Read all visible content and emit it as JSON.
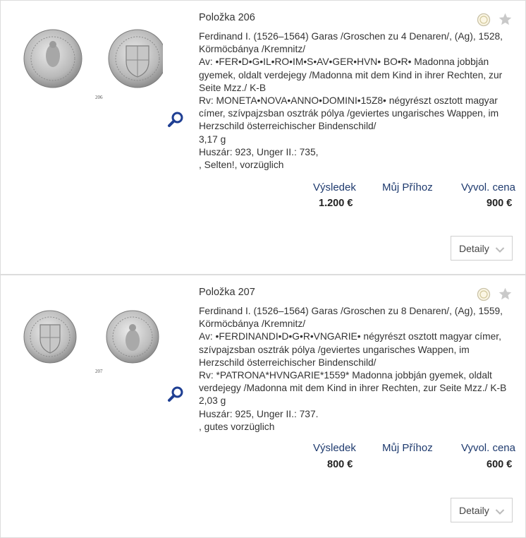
{
  "lots": [
    {
      "title": "Položka 206",
      "lines": [
        "Ferdinand I. (1526–1564) Garas /Groschen zu 4 Denaren/, (Ag), 1528,",
        "Körmöcbánya /Kremnitz/",
        "Av: •FER•D•G•IL•RO•IM•S•AV•GER•HVN• BO•R• Madonna jobbján",
        "gyemek, oldalt verdejegy /Madonna mit dem Kind in ihrer Rechten, zur",
        "Seite Mzz./ K-B",
        "Rv: MONETA•NOVA•ANNO•DOMINI•15Z8• négyrészt osztott magyar",
        "címer, szívpajzsban osztrák pólya /geviertes ungarisches Wappen, im",
        "Herzschild österreichischer Bindenschild/",
        "3,17 g",
        "Huszár: 923, Unger II.: 735,",
        ", Selten!, vorzüglich"
      ],
      "image_number": "206",
      "result_label": "Výsledek",
      "result_value": "1.200 €",
      "mybid_label": "Můj Příhoz",
      "start_label": "Vyvol. cena",
      "start_value": "900 €",
      "detail_label": "Detaily"
    },
    {
      "title": "Položka 207",
      "lines": [
        "Ferdinand I. (1526–1564) Garas /Groschen zu 8 Denaren/, (Ag), 1559,",
        "Körmöcbánya /Kremnitz/",
        "Av: •FERDINANDI•D•G•R•VNGARIE• négyrészt osztott magyar címer,",
        "szívpajzsban osztrák pólya /geviertes ungarisches Wappen, im",
        "Herzschild österreichischer Bindenschild/",
        "Rv: *PATRONA*HVNGARIE*1559* Madonna jobbján gyemek, oldalt",
        "verdejegy /Madonna mit dem Kind in ihrer Rechten, zur Seite Mzz./ K-B",
        "2,03 g",
        "Huszár: 925, Unger II.: 737.",
        ", gutes vorzüglich"
      ],
      "image_number": "207",
      "result_label": "Výsledek",
      "result_value": "800 €",
      "mybid_label": "Můj Příhoz",
      "start_label": "Vyvol. cena",
      "start_value": "600 €",
      "detail_label": "Detaily"
    }
  ],
  "icons": {
    "zoom": "magnifier-icon",
    "watch": "coin-watch-icon",
    "favorite": "star-icon",
    "chevron": "chevron-down-icon"
  },
  "colors": {
    "label_blue": "#1e3a6e",
    "zoom_blue": "#1f3f93",
    "star_grey": "#c9c9c9",
    "border": "#dcdcdc"
  }
}
